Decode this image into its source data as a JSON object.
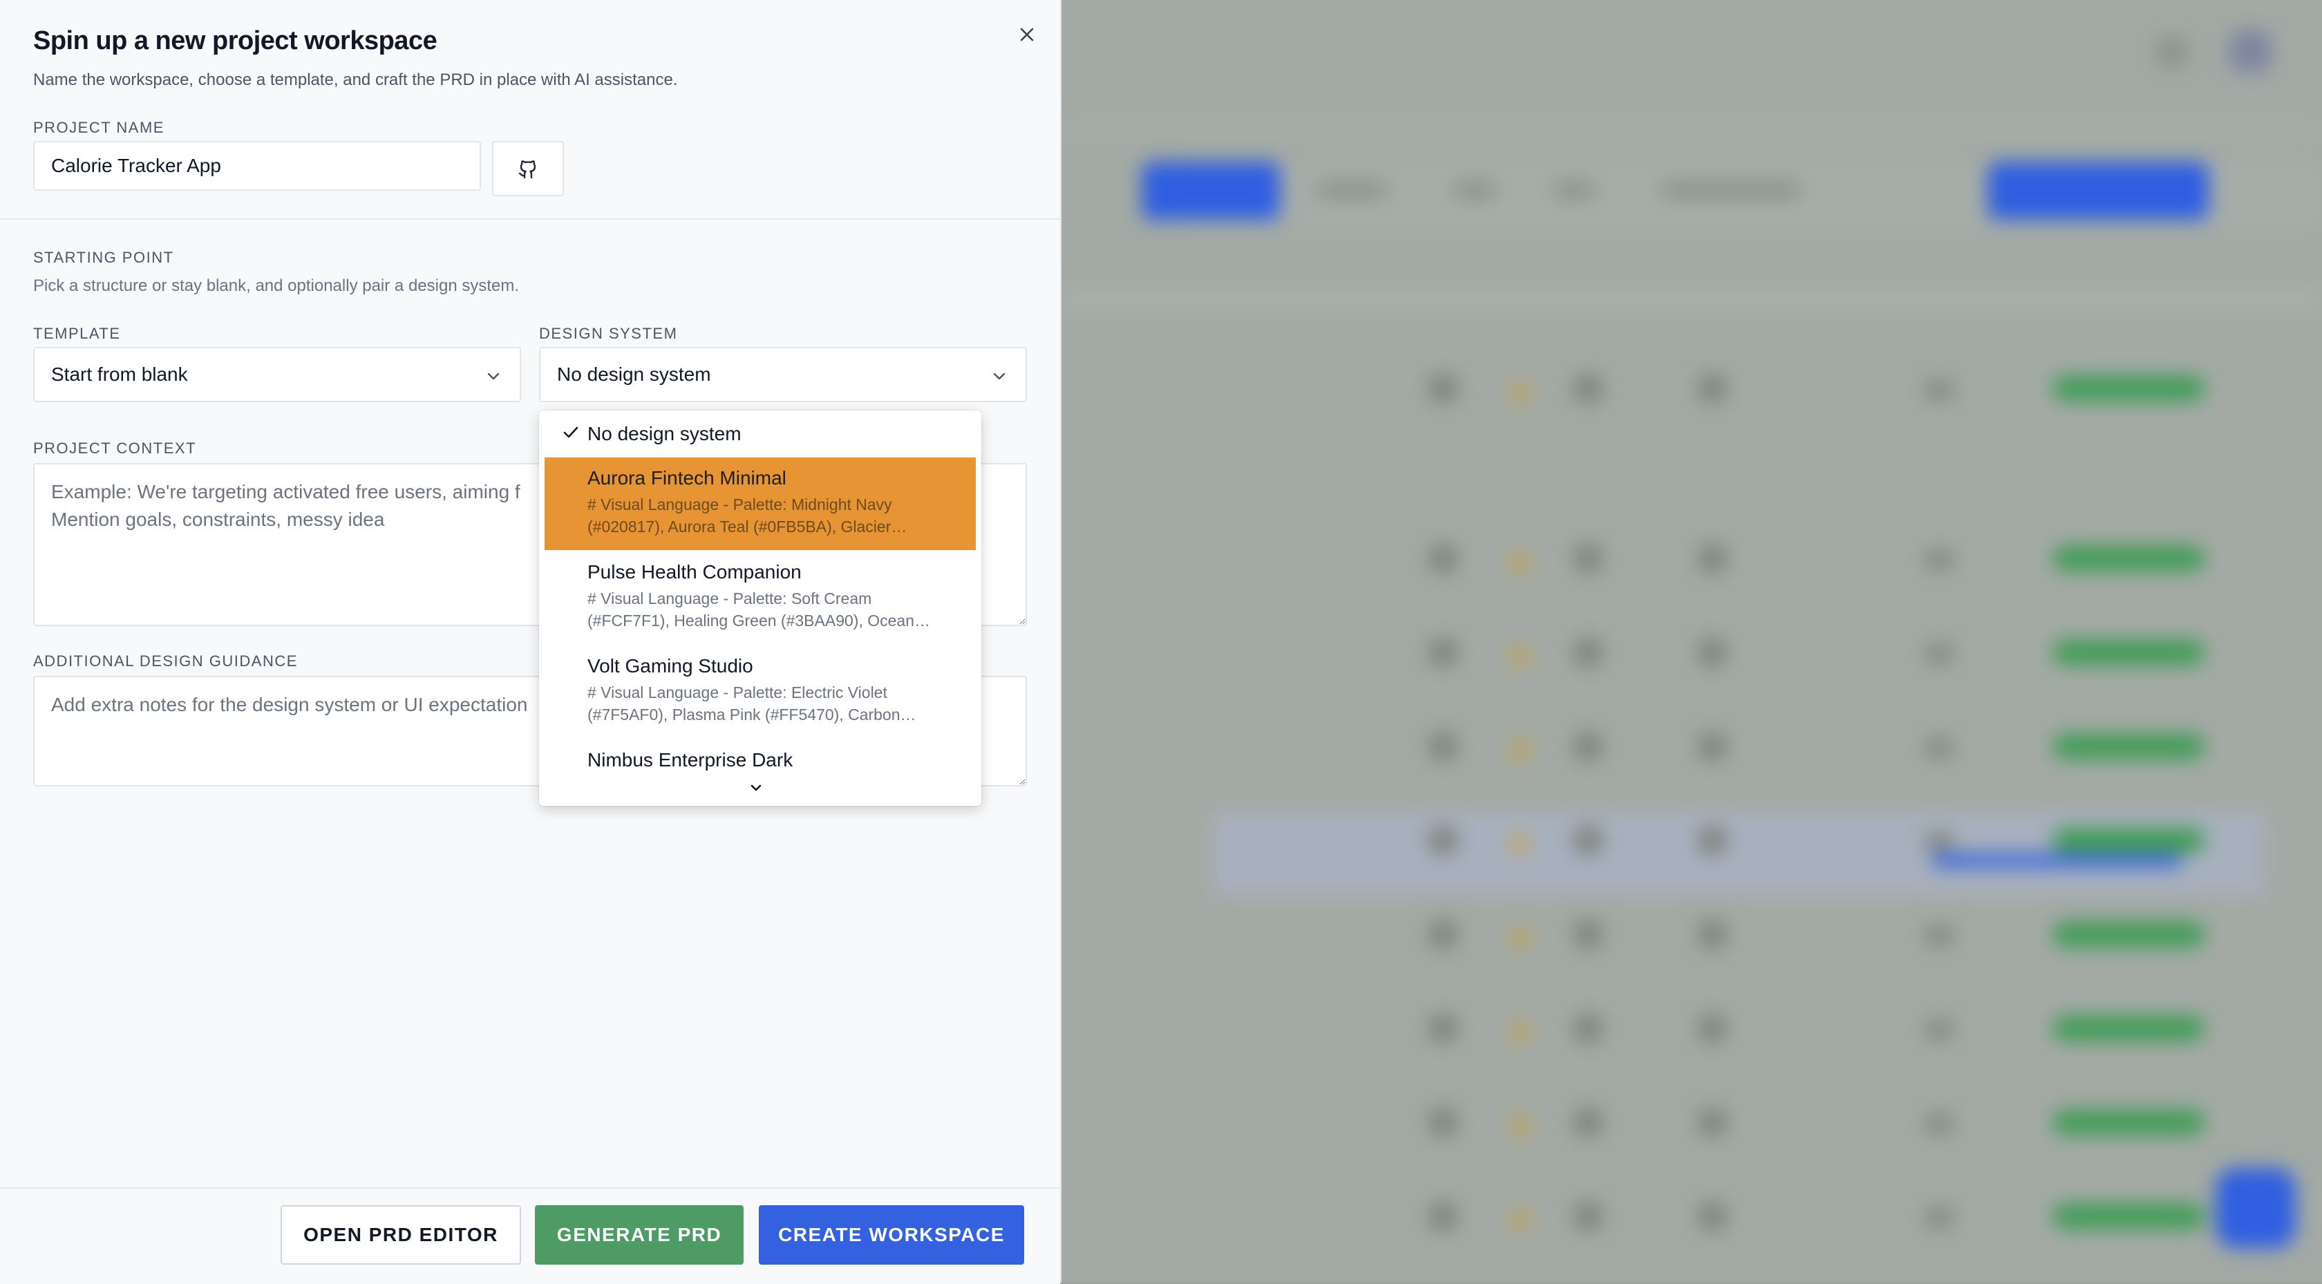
{
  "dialog": {
    "title": "Spin up a new project workspace",
    "subtitle": "Name the workspace, choose a template, and craft the PRD in place with AI assistance.",
    "project_name_label": "PROJECT NAME",
    "project_name_value": "Calorie Tracker App",
    "starting_point_label": "STARTING POINT",
    "starting_point_hint": "Pick a structure or stay blank, and optionally pair a design system.",
    "template_label": "TEMPLATE",
    "template_value": "Start from blank",
    "design_system_label": "DESIGN SYSTEM",
    "design_system_value": "No design system",
    "project_context_label": "PROJECT CONTEXT",
    "project_context_placeholder": "Example: We're targeting activated free users, aiming f                                                       n risk is medium. Mention goals, constraints, messy idea",
    "additional_guidance_label": "ADDITIONAL DESIGN GUIDANCE",
    "additional_guidance_placeholder": "Add extra notes for the design system or UI expectation"
  },
  "dropdown": {
    "selected": "No design system",
    "options": [
      {
        "name": "Aurora Fintech Minimal",
        "desc1": "# Visual Language - Palette: Midnight Navy",
        "desc2": "(#020817), Aurora Teal (#0FB5BA), Glacier…",
        "highlighted": true
      },
      {
        "name": "Pulse Health Companion",
        "desc1": "# Visual Language - Palette: Soft Cream",
        "desc2": "(#FCF7F1), Healing Green (#3BAA90), Ocean…",
        "highlighted": false
      },
      {
        "name": "Volt Gaming Studio",
        "desc1": "# Visual Language - Palette: Electric Violet",
        "desc2": "(#7F5AF0), Plasma Pink (#FF5470), Carbon…",
        "highlighted": false
      },
      {
        "name": "Nimbus Enterprise Dark",
        "desc1": "",
        "desc2": "",
        "highlighted": false
      }
    ]
  },
  "footer": {
    "open_prd_editor": "OPEN PRD EDITOR",
    "generate_prd": "GENERATE PRD",
    "create_workspace": "CREATE WORKSPACE"
  },
  "icons": {
    "close": "close-icon",
    "github": "github-icon",
    "chevron": "chevron-down-icon",
    "check": "check-icon"
  },
  "colors": {
    "highlight": "#e79434",
    "generate": "#4f9b65",
    "create": "#3461e0"
  }
}
